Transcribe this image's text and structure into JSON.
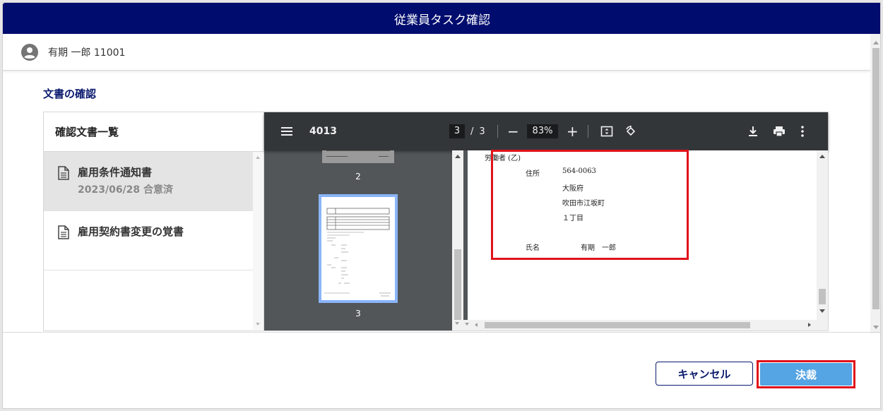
{
  "window": {
    "title": "従業員タスク確認"
  },
  "user": {
    "name": "有期 一郎 11001"
  },
  "section": {
    "title": "文書の確認"
  },
  "doclist": {
    "header": "確認文書一覧",
    "items": [
      {
        "title": "雇用条件通知書",
        "status": "2023/06/28 合意済",
        "active": true
      },
      {
        "title": "雇用契約書変更の覚書",
        "status": "",
        "active": false
      }
    ]
  },
  "viewer": {
    "doc_name": "4013",
    "current_page": "3",
    "page_separator": "/",
    "total_pages": "3",
    "zoom": "83%",
    "zoom_minus": "−",
    "zoom_plus": "+",
    "thumbnails": [
      {
        "label": "2"
      },
      {
        "label": "3"
      }
    ],
    "page_content": {
      "heading": "労働者 (乙)",
      "address_label": "住所",
      "postal_code": "564-0063",
      "prefecture": "大阪府",
      "city": "吹田市江坂町",
      "block": "１丁目",
      "name_label": "氏名",
      "name_value": "有期　一郎"
    }
  },
  "buttons": {
    "cancel": "キャンセル",
    "decide": "決裁"
  },
  "colors": {
    "title_bar": "#000c6e",
    "accent": "#55a4e3",
    "highlight": "#e0121a",
    "viewer_toolbar": "#323639"
  }
}
